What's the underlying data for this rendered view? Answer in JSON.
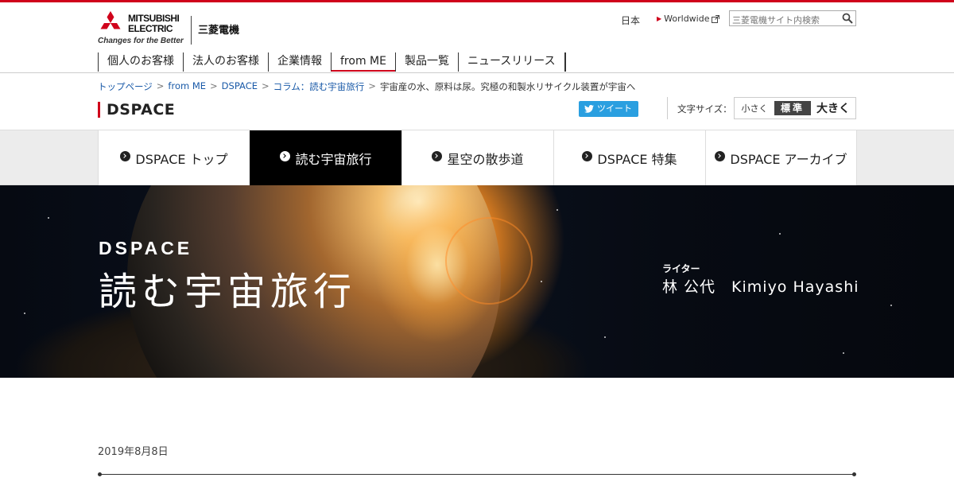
{
  "brand": {
    "name_line1": "MITSUBISHI",
    "name_line2": "ELECTRIC",
    "tagline": "Changes for the Better",
    "japanese_name": "三菱電機",
    "accent_color": "#d0021b"
  },
  "utility": {
    "japan_link": "日本",
    "worldwide_link": "Worldwide",
    "search_placeholder": "三菱電機サイト内検索"
  },
  "global_nav": {
    "items": [
      {
        "label": "個人のお客様"
      },
      {
        "label": "法人のお客様"
      },
      {
        "label": "企業情報"
      },
      {
        "label": "from ME",
        "active": true
      },
      {
        "label": "製品一覧"
      },
      {
        "label": "ニュースリリース"
      }
    ]
  },
  "breadcrumb": {
    "items": [
      "トップページ",
      "from ME",
      "DSPACE",
      "コラム：読む宇宙旅行"
    ],
    "separator": ">",
    "current": "宇宙産の水、原料は尿。究極の和製水リサイクル装置が宇宙へ"
  },
  "section": {
    "title": "DSPACE",
    "tweet_label": "ツイート",
    "font_size_label": "文字サイズ：",
    "font_small": "小さく",
    "font_standard": "標準",
    "font_large": "大きく"
  },
  "sub_nav": {
    "items": [
      {
        "label": "DSPACE トップ"
      },
      {
        "label": "読む宇宙旅行",
        "active": true
      },
      {
        "label": "星空の散歩道"
      },
      {
        "label": "DSPACE 特集"
      },
      {
        "label": "DSPACE アーカイブ"
      }
    ]
  },
  "hero": {
    "brand": "DSPACE",
    "title": "読む宇宙旅行",
    "writer_label": "ライター",
    "writer_name": "林 公代　Kimiyo Hayashi"
  },
  "article": {
    "date": "2019年8月8日"
  }
}
